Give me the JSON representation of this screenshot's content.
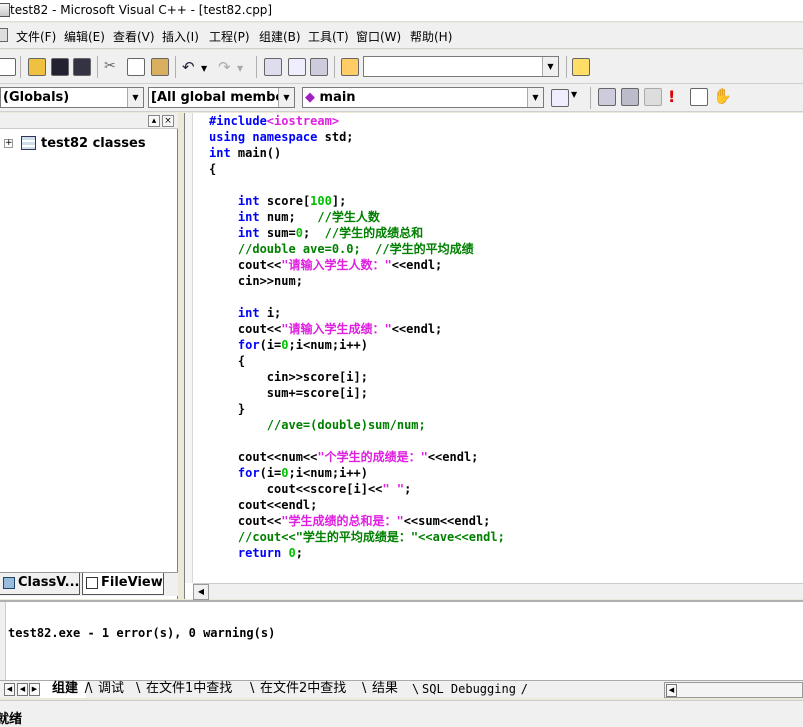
{
  "window": {
    "title": "test82 - Microsoft Visual C++ - [test82.cpp]"
  },
  "menu": [
    "文件(F)",
    "编辑(E)",
    "查看(V)",
    "插入(I)",
    "工程(P)",
    "组建(B)",
    "工具(T)",
    "窗口(W)",
    "帮助(H)"
  ],
  "toolbar": {
    "find_combo_value": "",
    "class_combo": "(Globals)",
    "members_combo": "[All global members",
    "function_combo": "main"
  },
  "workspace": {
    "tree_root": "test82 classes",
    "tabs": [
      "ClassV...",
      "FileView"
    ]
  },
  "code_lines": [
    [
      {
        "t": "#include",
        "c": "k"
      },
      {
        "t": "<iostream>",
        "c": "s"
      }
    ],
    [
      {
        "t": "using",
        "c": "k"
      },
      {
        "t": " ",
        "c": "t"
      },
      {
        "t": "namespace",
        "c": "k"
      },
      {
        "t": " std;",
        "c": "t"
      }
    ],
    [
      {
        "t": "int",
        "c": "k"
      },
      {
        "t": " main()",
        "c": "t"
      }
    ],
    [
      {
        "t": "{",
        "c": "t"
      }
    ],
    [],
    [
      {
        "t": "    ",
        "c": "t"
      },
      {
        "t": "int",
        "c": "k"
      },
      {
        "t": " score[",
        "c": "t"
      },
      {
        "t": "100",
        "c": "n"
      },
      {
        "t": "];",
        "c": "t"
      }
    ],
    [
      {
        "t": "    ",
        "c": "t"
      },
      {
        "t": "int",
        "c": "k"
      },
      {
        "t": " num;   ",
        "c": "t"
      },
      {
        "t": "//学生人数",
        "c": "c"
      }
    ],
    [
      {
        "t": "    ",
        "c": "t"
      },
      {
        "t": "int",
        "c": "k"
      },
      {
        "t": " sum=",
        "c": "t"
      },
      {
        "t": "0",
        "c": "n"
      },
      {
        "t": ";  ",
        "c": "t"
      },
      {
        "t": "//学生的成绩总和",
        "c": "c"
      }
    ],
    [
      {
        "t": "    ",
        "c": "t"
      },
      {
        "t": "//double ave=0.0;  //学生的平均成绩",
        "c": "c"
      }
    ],
    [
      {
        "t": "    cout<<",
        "c": "t"
      },
      {
        "t": "\"请输入学生人数：\"",
        "c": "s"
      },
      {
        "t": "<<endl;",
        "c": "t"
      }
    ],
    [
      {
        "t": "    cin>>num;",
        "c": "t"
      }
    ],
    [],
    [
      {
        "t": "    ",
        "c": "t"
      },
      {
        "t": "int",
        "c": "k"
      },
      {
        "t": " i;",
        "c": "t"
      }
    ],
    [
      {
        "t": "    cout<<",
        "c": "t"
      },
      {
        "t": "\"请输入学生成绩：\"",
        "c": "s"
      },
      {
        "t": "<<endl;",
        "c": "t"
      }
    ],
    [
      {
        "t": "    ",
        "c": "t"
      },
      {
        "t": "for",
        "c": "k"
      },
      {
        "t": "(i=",
        "c": "t"
      },
      {
        "t": "0",
        "c": "n"
      },
      {
        "t": ";i<num;i++)",
        "c": "t"
      }
    ],
    [
      {
        "t": "    {",
        "c": "t"
      }
    ],
    [
      {
        "t": "        cin>>score[i];",
        "c": "t"
      }
    ],
    [
      {
        "t": "        sum+=score[i];",
        "c": "t"
      }
    ],
    [
      {
        "t": "    }",
        "c": "t"
      }
    ],
    [
      {
        "t": "        ",
        "c": "t"
      },
      {
        "t": "//ave=(double)sum/num;",
        "c": "c"
      }
    ],
    [],
    [
      {
        "t": "    cout<<num<<",
        "c": "t"
      },
      {
        "t": "\"个学生的成绩是：\"",
        "c": "s"
      },
      {
        "t": "<<endl;",
        "c": "t"
      }
    ],
    [
      {
        "t": "    ",
        "c": "t"
      },
      {
        "t": "for",
        "c": "k"
      },
      {
        "t": "(i=",
        "c": "t"
      },
      {
        "t": "0",
        "c": "n"
      },
      {
        "t": ";i<num;i++)",
        "c": "t"
      }
    ],
    [
      {
        "t": "        cout<<score[i]<<",
        "c": "t"
      },
      {
        "t": "\" \"",
        "c": "s"
      },
      {
        "t": ";",
        "c": "t"
      }
    ],
    [
      {
        "t": "    cout<<endl;",
        "c": "t"
      }
    ],
    [
      {
        "t": "    cout<<",
        "c": "t"
      },
      {
        "t": "\"学生成绩的总和是：\"",
        "c": "s"
      },
      {
        "t": "<<sum<<endl;",
        "c": "t"
      }
    ],
    [
      {
        "t": "    ",
        "c": "t"
      },
      {
        "t": "//cout<<\"学生的平均成绩是：\"<<ave<<endl;",
        "c": "c"
      }
    ],
    [
      {
        "t": "    ",
        "c": "t"
      },
      {
        "t": "return",
        "c": "k"
      },
      {
        "t": " ",
        "c": "t"
      },
      {
        "t": "0",
        "c": "n"
      },
      {
        "t": ";",
        "c": "t"
      }
    ]
  ],
  "output": {
    "text": "test82.exe - 1 error(s), 0 warning(s)",
    "tabs": [
      "组建",
      "调试",
      "在文件1中查找",
      "在文件2中查找",
      "结果",
      "SQL Debugging"
    ]
  },
  "status": {
    "text": "就绪"
  },
  "colors": {
    "keyword": "#0000ff",
    "comment": "#008000",
    "string": "#e020e0",
    "number": "#00c000"
  },
  "icons": [
    "doc-icon",
    "open-folder-icon",
    "save-icon",
    "save-all-icon",
    "cut-icon",
    "copy-icon",
    "paste-icon",
    "undo-icon",
    "redo-icon",
    "workspace-icon",
    "output-icon",
    "window-list-icon",
    "find-in-files-icon",
    "find-icon",
    "wizard-icon",
    "compile-icon",
    "build-icon",
    "stop-build-icon",
    "execute-icon",
    "go-icon",
    "breakpoint-icon",
    "classes-icon",
    "fileview-icon"
  ]
}
